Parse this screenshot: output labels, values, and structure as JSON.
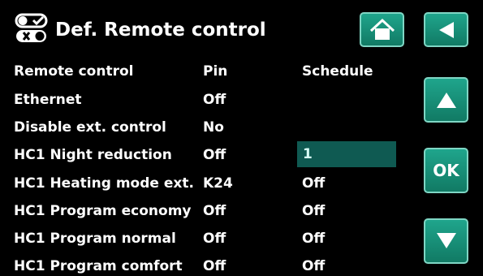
{
  "header": {
    "title": "Def. Remote control",
    "icons": [
      "toggle-switch-icon",
      "home-icon",
      "back-arrow-icon"
    ]
  },
  "table": {
    "headers": [
      "Remote control",
      "Pin",
      "Schedule"
    ],
    "rows": [
      {
        "label": "Ethernet",
        "pin": "Off",
        "schedule": ""
      },
      {
        "label": "Disable ext. control",
        "pin": "No",
        "schedule": ""
      },
      {
        "label": "HC1 Night reduction",
        "pin": "Off",
        "schedule": "1"
      },
      {
        "label": "HC1 Heating mode ext.",
        "pin": "K24",
        "schedule": "Off"
      },
      {
        "label": "HC1 Program economy",
        "pin": "Off",
        "schedule": "Off"
      },
      {
        "label": "HC1 Program normal",
        "pin": "Off",
        "schedule": "Off"
      },
      {
        "label": "HC1 Program comfort",
        "pin": "Off",
        "schedule": "Off"
      }
    ]
  },
  "navigation": {
    "ok_label": "OK",
    "up_icon": "up-arrow-icon",
    "down_icon": "down-arrow-icon"
  },
  "colors": {
    "background": "#000000",
    "button": "#1fa58c",
    "selected_cell": "#0f5a52"
  }
}
